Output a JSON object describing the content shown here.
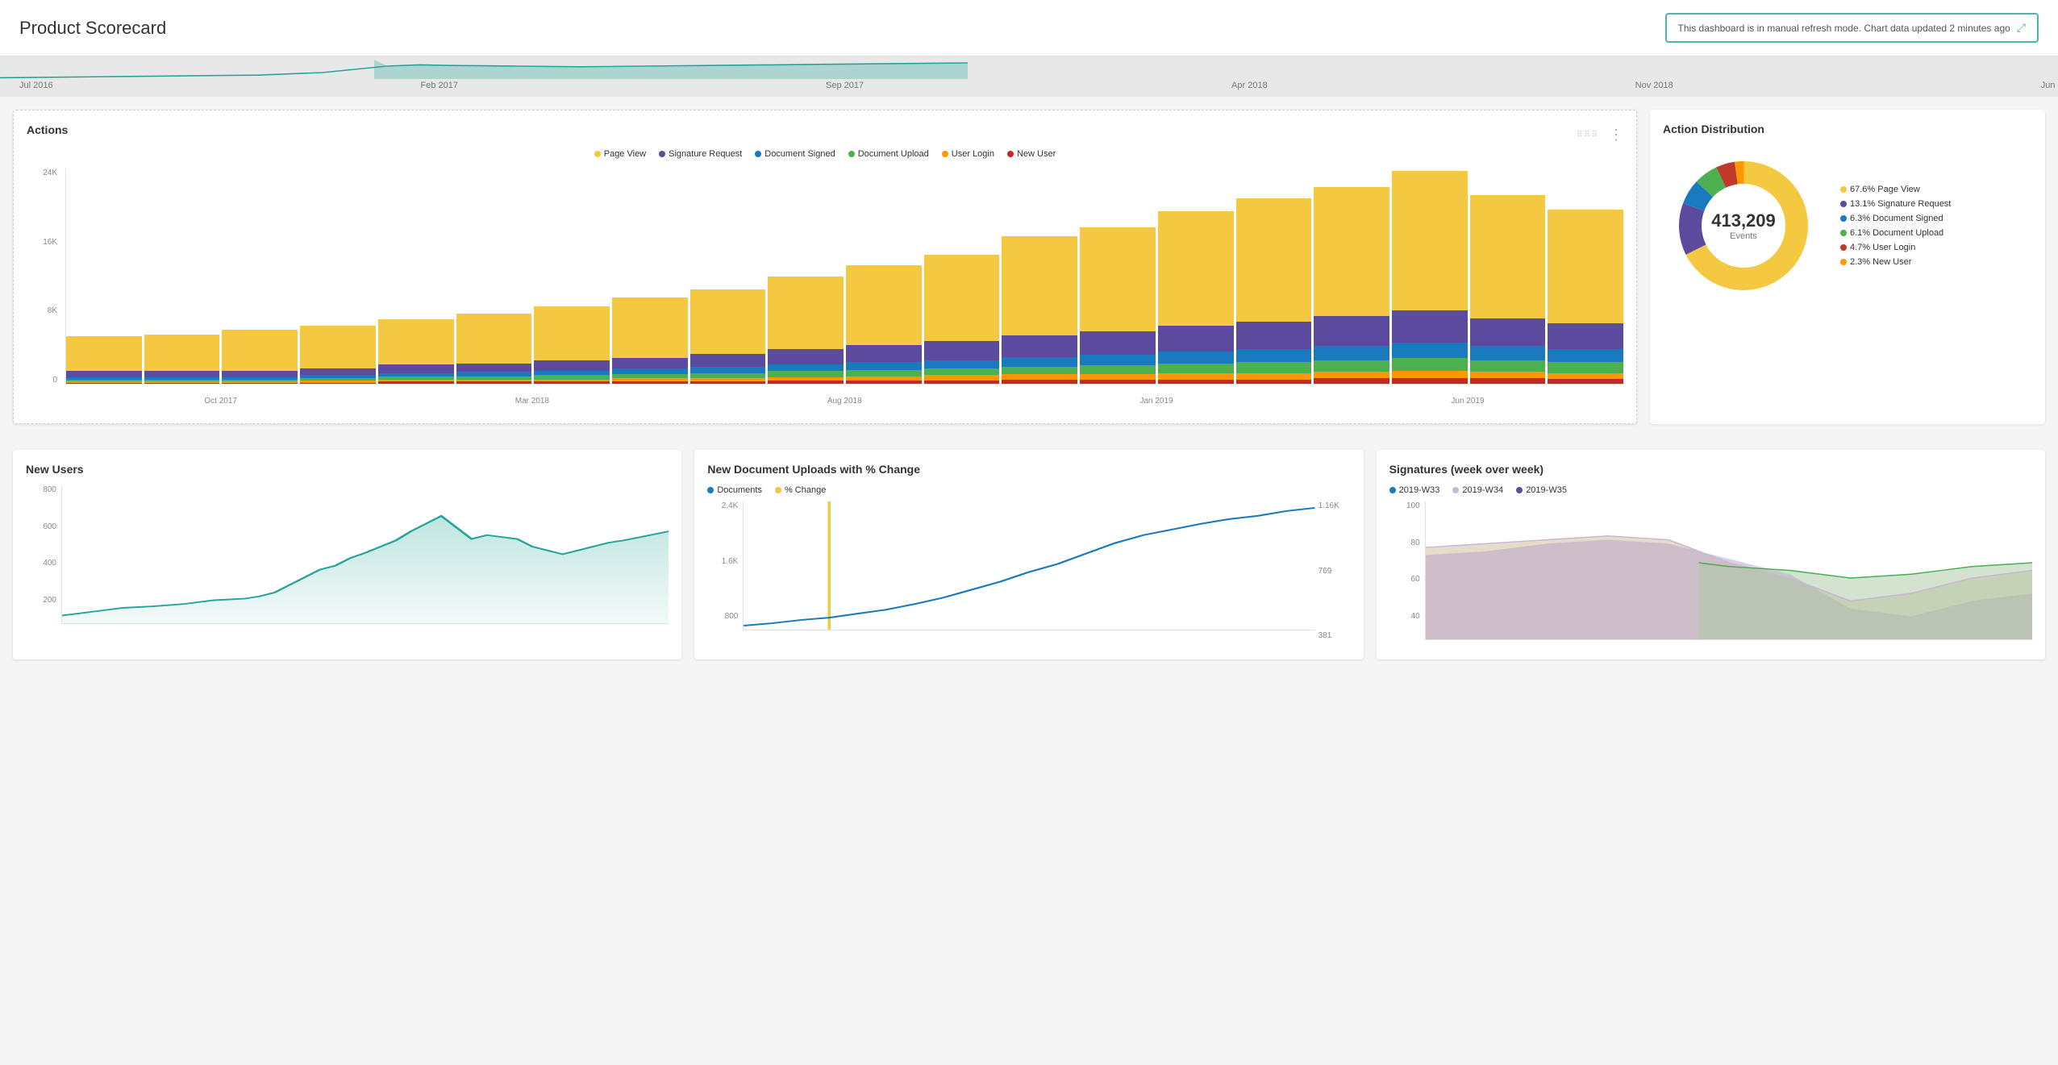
{
  "header": {
    "title": "Product Scorecard",
    "refresh_notice": "This dashboard is in manual refresh mode. Chart data updated 2 minutes ago"
  },
  "timeline": {
    "labels": [
      "Jul 2016",
      "Feb 2017",
      "Sep 2017",
      "Apr 2018",
      "Nov 2018",
      "Jun 2019"
    ]
  },
  "actions_chart": {
    "title": "Actions",
    "legend": [
      {
        "label": "Page View",
        "color": "#f5c842"
      },
      {
        "label": "Signature Request",
        "color": "#5c4a9e"
      },
      {
        "label": "Document Signed",
        "color": "#1a7abf"
      },
      {
        "label": "Document Upload",
        "color": "#4caf50"
      },
      {
        "label": "User Login",
        "color": "#ff9800"
      },
      {
        "label": "New User",
        "color": "#c62828"
      }
    ],
    "y_labels": [
      "24K",
      "16K",
      "8K",
      "0"
    ],
    "x_labels": [
      "Oct 2017",
      "Mar 2018",
      "Aug 2018",
      "Jan 2019",
      "Jun 2019"
    ],
    "bars": [
      {
        "total": 0.22,
        "segments": [
          0.16,
          0.03,
          0.01,
          0.01,
          0.005,
          0.005
        ]
      },
      {
        "total": 0.24,
        "segments": [
          0.17,
          0.03,
          0.01,
          0.01,
          0.005,
          0.005
        ]
      },
      {
        "total": 0.26,
        "segments": [
          0.19,
          0.03,
          0.01,
          0.01,
          0.005,
          0.005
        ]
      },
      {
        "total": 0.28,
        "segments": [
          0.2,
          0.03,
          0.015,
          0.01,
          0.01,
          0.005
        ]
      },
      {
        "total": 0.3,
        "segments": [
          0.21,
          0.04,
          0.015,
          0.015,
          0.01,
          0.01
        ]
      },
      {
        "total": 0.33,
        "segments": [
          0.23,
          0.04,
          0.02,
          0.015,
          0.01,
          0.01
        ]
      },
      {
        "total": 0.36,
        "segments": [
          0.25,
          0.05,
          0.02,
          0.02,
          0.01,
          0.01
        ]
      },
      {
        "total": 0.4,
        "segments": [
          0.28,
          0.05,
          0.025,
          0.02,
          0.015,
          0.01
        ]
      },
      {
        "total": 0.44,
        "segments": [
          0.3,
          0.06,
          0.03,
          0.025,
          0.015,
          0.01
        ]
      },
      {
        "total": 0.5,
        "segments": [
          0.34,
          0.07,
          0.03,
          0.03,
          0.015,
          0.015
        ]
      },
      {
        "total": 0.55,
        "segments": [
          0.37,
          0.08,
          0.035,
          0.03,
          0.02,
          0.015
        ]
      },
      {
        "total": 0.6,
        "segments": [
          0.4,
          0.09,
          0.04,
          0.03,
          0.025,
          0.015
        ]
      },
      {
        "total": 0.68,
        "segments": [
          0.46,
          0.1,
          0.045,
          0.035,
          0.025,
          0.02
        ]
      },
      {
        "total": 0.72,
        "segments": [
          0.48,
          0.11,
          0.05,
          0.04,
          0.025,
          0.02
        ]
      },
      {
        "total": 0.8,
        "segments": [
          0.53,
          0.12,
          0.055,
          0.045,
          0.03,
          0.02
        ]
      },
      {
        "total": 0.87,
        "segments": [
          0.57,
          0.13,
          0.06,
          0.05,
          0.03,
          0.02
        ]
      },
      {
        "total": 0.92,
        "segments": [
          0.6,
          0.14,
          0.065,
          0.055,
          0.03,
          0.025
        ]
      },
      {
        "total": 1.0,
        "segments": [
          0.65,
          0.15,
          0.07,
          0.06,
          0.035,
          0.025
        ]
      },
      {
        "total": 0.88,
        "segments": [
          0.57,
          0.13,
          0.065,
          0.055,
          0.03,
          0.025
        ]
      },
      {
        "total": 0.82,
        "segments": [
          0.53,
          0.12,
          0.06,
          0.05,
          0.028,
          0.022
        ]
      }
    ]
  },
  "action_distribution": {
    "title": "Action Distribution",
    "total": "413,209",
    "events_label": "Events",
    "segments": [
      {
        "label": "67.6% Page View",
        "pct": 67.6,
        "color": "#f5c842"
      },
      {
        "label": "13.1% Signature Request",
        "pct": 13.1,
        "color": "#5c4a9e"
      },
      {
        "label": "6.3% Document Signed",
        "pct": 6.3,
        "color": "#1a7abf"
      },
      {
        "label": "6.1% Document Upload",
        "pct": 6.1,
        "color": "#4caf50"
      },
      {
        "label": "4.7% User Login",
        "pct": 4.7,
        "color": "#c0392b"
      },
      {
        "label": "2.3% New User",
        "pct": 2.3,
        "color": "#ff9800"
      }
    ]
  },
  "new_users": {
    "title": "New Users",
    "y_labels": [
      "800",
      "600",
      "400",
      "200"
    ]
  },
  "doc_uploads": {
    "title": "New Document Uploads with % Change",
    "legend_docs": "Documents",
    "legend_pct": "% Change",
    "y_left_labels": [
      "2.4K",
      "1.6K",
      "800"
    ],
    "y_right_labels": [
      "1.16K",
      "769",
      "381"
    ]
  },
  "signatures": {
    "title": "Signatures (week over week)",
    "legend": [
      {
        "label": "2019-W33",
        "color": "#1a7abf"
      },
      {
        "label": "2019-W34",
        "color": "#c8b8d8"
      },
      {
        "label": "2019-W35",
        "color": "#5c4a9e"
      }
    ],
    "y_labels": [
      "100",
      "80",
      "60",
      "40"
    ]
  }
}
